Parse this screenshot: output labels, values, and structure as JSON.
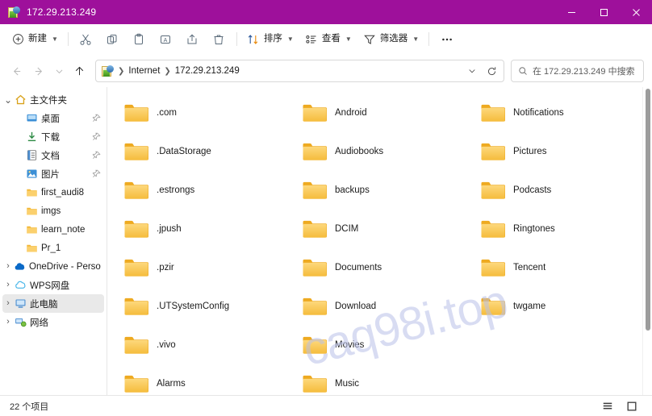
{
  "window": {
    "title": "172.29.213.249",
    "titlebar_color": "#9E109B",
    "icon": "network-folder-icon",
    "controls": {
      "minimize": "minimize-icon",
      "maximize": "maximize-icon",
      "close": "close-icon"
    }
  },
  "toolbar": {
    "new_label": "新建",
    "cut_label": "剪切",
    "copy_label": "复制",
    "paste_label": "粘贴",
    "rename_label": "重命名",
    "share_label": "共享",
    "delete_label": "删除",
    "sort_label": "排序",
    "view_label": "查看",
    "filter_label": "筛选器",
    "more_label": "···"
  },
  "nav": {
    "back": "back-arrow",
    "forward": "forward-arrow",
    "recent": "recent-chevron",
    "up": "up-arrow",
    "refresh": "refresh-icon",
    "breadcrumb": [
      "Internet",
      "172.29.213.249"
    ],
    "dropdown": "chevron-down-icon"
  },
  "search": {
    "placeholder": "在 172.29.213.249 中搜索",
    "icon": "search-icon"
  },
  "sidebar": {
    "items": [
      {
        "label": "主文件夹",
        "icon": "home-icon",
        "indent": 0,
        "twisty": "v",
        "pin": false,
        "selected": false
      },
      {
        "label": "桌面",
        "icon": "desktop-icon",
        "indent": 1,
        "twisty": "",
        "pin": true,
        "selected": false
      },
      {
        "label": "下载",
        "icon": "download-icon",
        "indent": 1,
        "twisty": "",
        "pin": true,
        "selected": false
      },
      {
        "label": "文档",
        "icon": "documents-icon",
        "indent": 1,
        "twisty": "",
        "pin": true,
        "selected": false
      },
      {
        "label": "图片",
        "icon": "pictures-icon",
        "indent": 1,
        "twisty": "",
        "pin": true,
        "selected": false
      },
      {
        "label": "first_audi8",
        "icon": "folder-icon",
        "indent": 1,
        "twisty": "",
        "pin": false,
        "selected": false
      },
      {
        "label": "imgs",
        "icon": "folder-icon",
        "indent": 1,
        "twisty": "",
        "pin": false,
        "selected": false
      },
      {
        "label": "learn_note",
        "icon": "folder-icon",
        "indent": 1,
        "twisty": "",
        "pin": false,
        "selected": false
      },
      {
        "label": "Pr_1",
        "icon": "folder-icon",
        "indent": 1,
        "twisty": "",
        "pin": false,
        "selected": false
      },
      {
        "label": "OneDrive - Persona",
        "icon": "onedrive-icon",
        "indent": 0,
        "twisty": ">",
        "pin": false,
        "selected": false
      },
      {
        "label": "WPS网盘",
        "icon": "wpscloud-icon",
        "indent": 0,
        "twisty": ">",
        "pin": false,
        "selected": false
      },
      {
        "label": "此电脑",
        "icon": "thispc-icon",
        "indent": 0,
        "twisty": ">",
        "pin": false,
        "selected": true
      },
      {
        "label": "网络",
        "icon": "network-icon",
        "indent": 0,
        "twisty": ">",
        "pin": false,
        "selected": false
      }
    ]
  },
  "files": [
    {
      "name": ".com",
      "type": "folder"
    },
    {
      "name": ".DataStorage",
      "type": "folder"
    },
    {
      "name": ".estrongs",
      "type": "folder"
    },
    {
      "name": ".jpush",
      "type": "folder"
    },
    {
      "name": ".pzir",
      "type": "folder"
    },
    {
      "name": ".UTSystemConfig",
      "type": "folder"
    },
    {
      "name": ".vivo",
      "type": "folder"
    },
    {
      "name": "Alarms",
      "type": "folder"
    },
    {
      "name": "Android",
      "type": "folder"
    },
    {
      "name": "Audiobooks",
      "type": "folder"
    },
    {
      "name": "backups",
      "type": "folder"
    },
    {
      "name": "DCIM",
      "type": "folder"
    },
    {
      "name": "Documents",
      "type": "folder"
    },
    {
      "name": "Download",
      "type": "folder"
    },
    {
      "name": "Movies",
      "type": "folder"
    },
    {
      "name": "Music",
      "type": "folder"
    },
    {
      "name": "Notifications",
      "type": "folder"
    },
    {
      "name": "Pictures",
      "type": "folder"
    },
    {
      "name": "Podcasts",
      "type": "folder"
    },
    {
      "name": "Ringtones",
      "type": "folder"
    },
    {
      "name": "Tencent",
      "type": "folder"
    },
    {
      "name": "twgame",
      "type": "folder"
    }
  ],
  "watermark": {
    "text": "caq98i.top",
    "color": "#b9c0e8"
  },
  "statusbar": {
    "item_count": "22 个项目",
    "view_list": "list-view-icon",
    "view_large": "large-icons-view-icon"
  }
}
